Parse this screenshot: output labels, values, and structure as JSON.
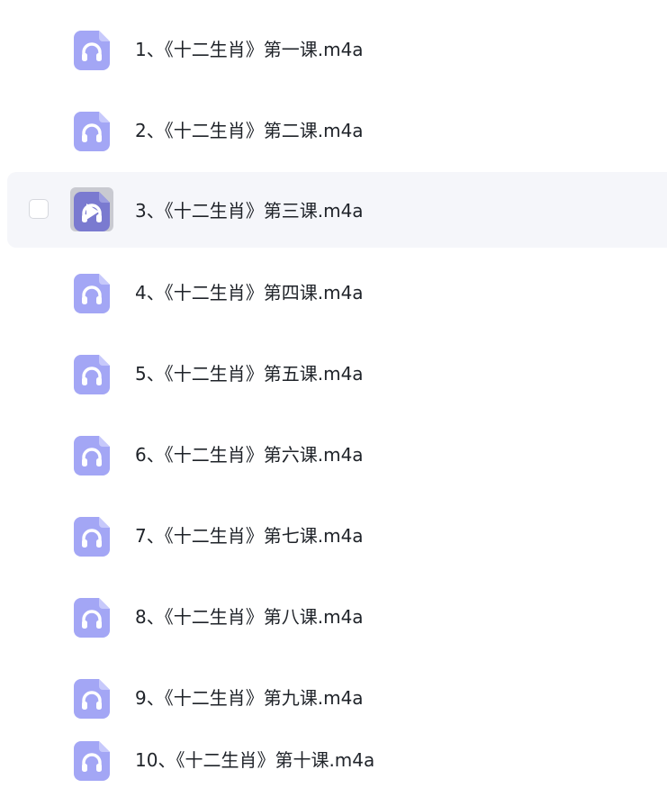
{
  "file_list": {
    "hovered_index": 2,
    "icon": "audio-file-headphones-icon",
    "icon_color": "#a3a6f5",
    "items": [
      {
        "name": "1、《十二生肖》第一课.m4a"
      },
      {
        "name": "2、《十二生肖》第二课.m4a"
      },
      {
        "name": "3、《十二生肖》第三课.m4a"
      },
      {
        "name": "4、《十二生肖》第四课.m4a"
      },
      {
        "name": "5、《十二生肖》第五课.m4a"
      },
      {
        "name": "6、《十二生肖》第六课.m4a"
      },
      {
        "name": "7、《十二生肖》第七课.m4a"
      },
      {
        "name": "8、《十二生肖》第八课.m4a"
      },
      {
        "name": "9、《十二生肖》第九课.m4a"
      },
      {
        "name": "10、《十二生肖》第十课.m4a"
      }
    ]
  }
}
